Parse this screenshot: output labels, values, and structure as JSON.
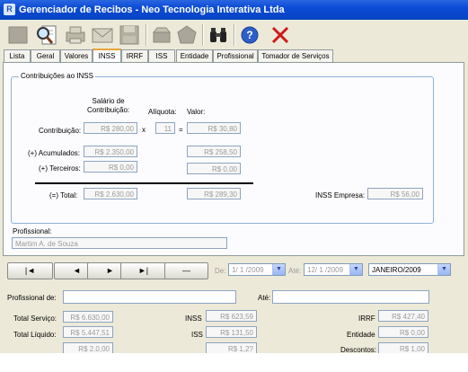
{
  "window": {
    "title": "Gerenciador de Recibos - Neo Tecnologia Interativa Ltda",
    "logo_letter": "R"
  },
  "toolbar": {
    "buttons": [
      {
        "name": "new-record-icon"
      },
      {
        "name": "search-document-icon"
      },
      {
        "name": "print-icon"
      },
      {
        "name": "email-icon"
      },
      {
        "name": "save-icon"
      },
      {
        "name": "archive-icon"
      },
      {
        "name": "tag-icon"
      },
      {
        "name": "binoculars-icon"
      },
      {
        "name": "help-icon"
      },
      {
        "name": "close-icon"
      }
    ]
  },
  "tabs": [
    "Lista",
    "Geral",
    "Valores",
    "INSS",
    "IRRF",
    "ISS",
    "Entidade",
    "Profissional",
    "Tomador de Serviços"
  ],
  "active_tab": "INSS",
  "inss": {
    "group_title": "Contribuições ao INSS",
    "header_salary": "Salário de\nContribuição:",
    "header_aliquota": "Alíquota:",
    "header_valor": "Valor:",
    "contribuicao_label": "Contribuição:",
    "contribuicao_value": "R$ 280,00",
    "x_sign": "x",
    "aliquota_value": "11",
    "eq_sign": "=",
    "valor_value": "R$ 30,80",
    "acumulados_label": "(+) Acumulados:",
    "acumulados_value": "R$ 2.350,00",
    "acumulados_valor": "R$ 258,50",
    "terceiros_label": "(+) Terceiros:",
    "terceiros_value": "R$ 0,00",
    "terceiros_valor": "R$ 0,00",
    "total_label": "(=) Total:",
    "total_value": "R$ 2.630,00",
    "total_valor": "R$ 289,30",
    "empresa_label": "INSS Empresa:",
    "empresa_value": "R$ 56,00",
    "profissional_label": "Profissional:",
    "profissional_value": "Martim A. de Souza"
  },
  "nav": {
    "first": "|◄",
    "prev": "◄",
    "next": "►",
    "last": "►|",
    "remove": "—",
    "de_label": "De:",
    "de_value": "1/ 1 /2009",
    "ate_label": "Até:",
    "ate_value": "12/ 1 /2009",
    "month_value": "JANEIRO/2009"
  },
  "filter": {
    "profissional_label": "Profissional de:",
    "ate_label": "Até:",
    "total_servico_label": "Total Serviço:",
    "total_servico_value": "R$ 6.630,00",
    "inss_label": "INSS",
    "inss_value": "R$ 623,59",
    "irrf_label": "IRRF",
    "irrf_value": "R$ 427,40",
    "total_liquido_label": "Total Líquido:",
    "total_liquido_value": "R$ 5.447,51",
    "iss_label": "ISS",
    "iss_value": "R$ 131,50",
    "entidade_label": "Entidade",
    "entidade_value": "R$ 0,00",
    "row3_value1": "R$ 2.0,00",
    "row3_value2": "R$ 1,2?",
    "descontos_label": "Descontos:",
    "descontos_value": "R$ 1,00"
  }
}
